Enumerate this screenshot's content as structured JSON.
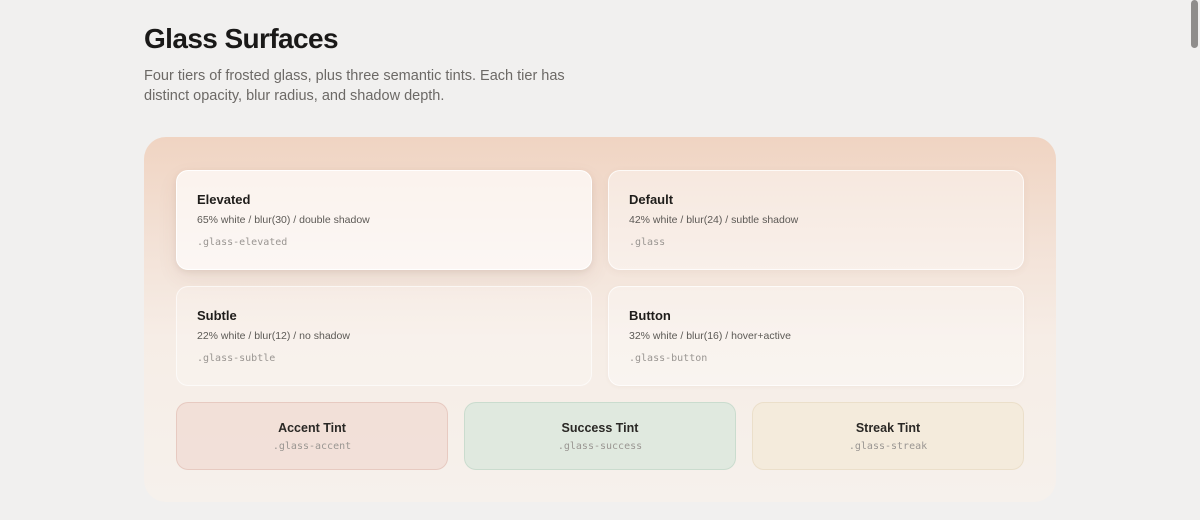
{
  "header": {
    "title": "Glass Surfaces",
    "description": "Four tiers of frosted glass, plus three semantic tints. Each tier has distinct opacity, blur radius, and shadow depth."
  },
  "tiers": [
    {
      "title": "Elevated",
      "spec": "65% white / blur(30) / double shadow",
      "class_name": ".glass-elevated"
    },
    {
      "title": "Default",
      "spec": "42% white / blur(24) / subtle shadow",
      "class_name": ".glass"
    },
    {
      "title": "Subtle",
      "spec": "22% white / blur(12) / no shadow",
      "class_name": ".glass-subtle"
    },
    {
      "title": "Button",
      "spec": "32% white / blur(16) / hover+active",
      "class_name": ".glass-button"
    }
  ],
  "tints": [
    {
      "title": "Accent Tint",
      "class_name": ".glass-accent",
      "color": "#f0d7d0"
    },
    {
      "title": "Success Tint",
      "class_name": ".glass-success",
      "color": "#dee8de"
    },
    {
      "title": "Streak Tint",
      "class_name": ".glass-streak",
      "color": "#f4eada"
    }
  ]
}
